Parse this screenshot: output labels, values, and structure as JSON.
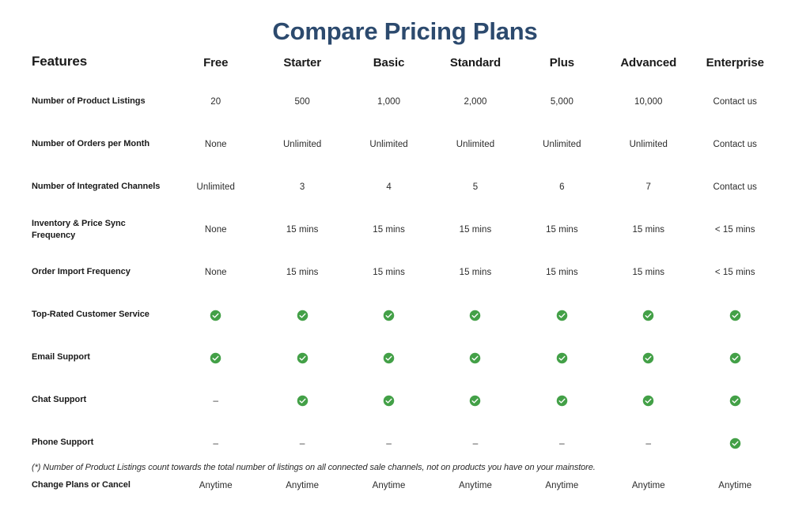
{
  "title": "Compare Pricing Plans",
  "theme": {
    "title_color": "#2c4a6e",
    "check_color": "#43a047",
    "text_color": "#1a1a1a",
    "background": "#ffffff"
  },
  "table": {
    "feature_header": "Features",
    "plans": [
      "Free",
      "Starter",
      "Basic",
      "Standard",
      "Plus",
      "Advanced",
      "Enterprise"
    ],
    "rows": [
      {
        "feature": "Number of Product Listings",
        "values": [
          "20",
          "500",
          "1,000",
          "2,000",
          "5,000",
          "10,000",
          "Contact us"
        ]
      },
      {
        "feature": "Number of Orders per Month",
        "values": [
          "None",
          "Unlimited",
          "Unlimited",
          "Unlimited",
          "Unlimited",
          "Unlimited",
          "Contact us"
        ]
      },
      {
        "feature": "Number of Integrated Channels",
        "values": [
          "Unlimited",
          "3",
          "4",
          "5",
          "6",
          "7",
          "Contact us"
        ]
      },
      {
        "feature": "Inventory & Price Sync Frequency",
        "values": [
          "None",
          "15 mins",
          "15 mins",
          "15 mins",
          "15 mins",
          "15 mins",
          "< 15 mins"
        ]
      },
      {
        "feature": "Order Import Frequency",
        "values": [
          "None",
          "15 mins",
          "15 mins",
          "15 mins",
          "15 mins",
          "15 mins",
          "< 15 mins"
        ]
      },
      {
        "feature": "Top-Rated Customer Service",
        "values": [
          "check",
          "check",
          "check",
          "check",
          "check",
          "check",
          "check"
        ]
      },
      {
        "feature": "Email Support",
        "values": [
          "check",
          "check",
          "check",
          "check",
          "check",
          "check",
          "check"
        ]
      },
      {
        "feature": "Chat Support",
        "values": [
          "dash",
          "check",
          "check",
          "check",
          "check",
          "check",
          "check"
        ]
      },
      {
        "feature": "Phone Support",
        "values": [
          "dash",
          "dash",
          "dash",
          "dash",
          "dash",
          "dash",
          "check"
        ]
      },
      {
        "feature": "Change Plans or Cancel",
        "values": [
          "Anytime",
          "Anytime",
          "Anytime",
          "Anytime",
          "Anytime",
          "Anytime",
          "Anytime"
        ]
      }
    ]
  },
  "footnote": "(*) Number of Product Listings count towards the total number of listings on all connected sale channels, not on products you have on your mainstore.",
  "symbols": {
    "dash": "–"
  }
}
